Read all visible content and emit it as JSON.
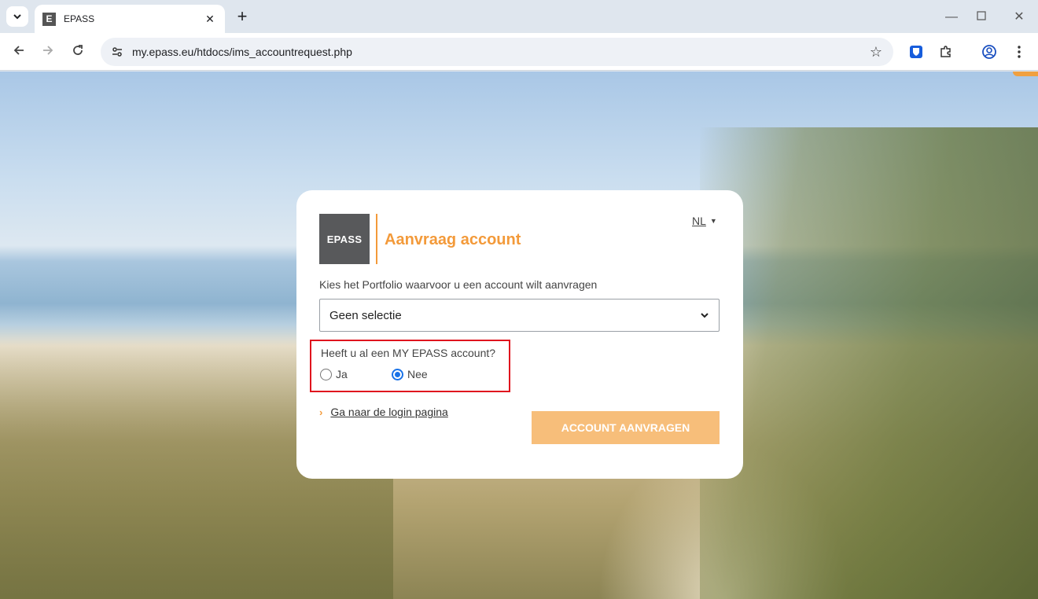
{
  "browser": {
    "tab_title": "EPASS",
    "favicon_letter": "E",
    "url": "my.epass.eu/htdocs/ims_accountrequest.php"
  },
  "card": {
    "logo_text": "EPASS",
    "title": "Aanvraag account",
    "language": "NL",
    "portfolio_label": "Kies het Portfolio waarvoor u een account wilt aanvragen",
    "portfolio_select": {
      "selected": "Geen selectie"
    },
    "account_question": "Heeft u al een MY EPASS account?",
    "radio_options": [
      {
        "label": "Ja",
        "checked": false
      },
      {
        "label": "Nee",
        "checked": true
      }
    ],
    "login_link": "Ga naar de login pagina",
    "submit_button": "ACCOUNT AANVRAGEN"
  },
  "colors": {
    "brand_orange": "#f39a3a",
    "button_orange": "#f7be7a",
    "highlight_red": "#e0141e",
    "radio_blue": "#1a73e8",
    "logo_gray": "#58595b"
  }
}
